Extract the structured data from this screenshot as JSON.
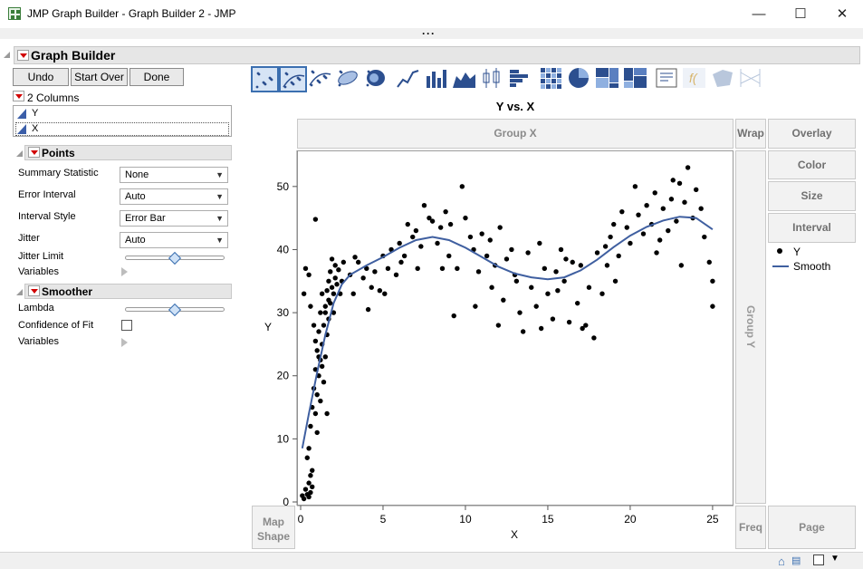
{
  "window": {
    "title": "JMP Graph Builder - Graph Builder 2 - JMP",
    "minimize": "—",
    "maximize": "☐",
    "close": "✕",
    "more": "···"
  },
  "graph_builder": {
    "title": "Graph Builder",
    "buttons": {
      "undo": "Undo",
      "start_over": "Start Over",
      "done": "Done"
    },
    "columns_header": "2 Columns",
    "columns": [
      "Y",
      "X"
    ]
  },
  "points": {
    "title": "Points",
    "summary_statistic_label": "Summary Statistic",
    "summary_statistic_value": "None",
    "error_interval_label": "Error Interval",
    "error_interval_value": "Auto",
    "interval_style_label": "Interval Style",
    "interval_style_value": "Error Bar",
    "jitter_label": "Jitter",
    "jitter_value": "Auto",
    "jitter_limit_label": "Jitter Limit",
    "jitter_limit_level": 0.5,
    "variables_label": "Variables"
  },
  "smoother": {
    "title": "Smoother",
    "lambda_label": "Lambda",
    "lambda_level": 0.5,
    "confidence_label": "Confidence of Fit",
    "confidence_checked": false,
    "variables_label": "Variables"
  },
  "toolbar_icons": [
    "points-icon",
    "contour-points-icon",
    "smoother-icon",
    "ellipse-icon",
    "contour-icon",
    "line-icon",
    "bar-icon",
    "area-icon",
    "box-plot-icon",
    "histogram-icon",
    "heatmap-icon",
    "pie-icon",
    "treemap-icon",
    "mosaic-icon",
    "caption-box-icon",
    "formula-icon",
    "map-shapes-icon",
    "parallel-icon"
  ],
  "zones": {
    "group_x": "Group X",
    "wrap": "Wrap",
    "overlay": "Overlay",
    "color": "Color",
    "size": "Size",
    "interval": "Interval",
    "group_y": "Group Y",
    "map_shape_1": "Map",
    "map_shape_2": "Shape",
    "freq": "Freq",
    "page": "Page"
  },
  "legend": {
    "points_label": "Y",
    "smooth_label": "Smooth"
  },
  "colors": {
    "smooth_line": "#3f5fa0",
    "points": "#000000",
    "accent": "#3b6fb0"
  },
  "chart_data": {
    "type": "scatter",
    "title": "Y vs. X",
    "xlabel": "X",
    "ylabel": "Y",
    "xlim": [
      0,
      25.5
    ],
    "ylim": [
      0,
      55
    ],
    "xticks": [
      0,
      5,
      10,
      15,
      20,
      25
    ],
    "yticks": [
      0,
      10,
      20,
      30,
      40,
      50
    ],
    "grid": false,
    "legend_position": "right",
    "series": [
      {
        "name": "Y",
        "kind": "points",
        "points": [
          [
            0.1,
            1.0
          ],
          [
            0.2,
            0.5
          ],
          [
            0.3,
            2.0
          ],
          [
            0.4,
            1.2
          ],
          [
            0.5,
            0.8
          ],
          [
            0.6,
            1.5
          ],
          [
            0.7,
            2.4
          ],
          [
            0.5,
            3.0
          ],
          [
            0.6,
            4.2
          ],
          [
            0.7,
            5.0
          ],
          [
            0.4,
            7.0
          ],
          [
            0.5,
            8.5
          ],
          [
            0.6,
            12.0
          ],
          [
            0.7,
            15.0
          ],
          [
            0.8,
            18.0
          ],
          [
            0.9,
            21.0
          ],
          [
            1.0,
            24.0
          ],
          [
            1.1,
            27.0
          ],
          [
            1.2,
            30.0
          ],
          [
            1.3,
            33.0
          ],
          [
            1.0,
            17.0
          ],
          [
            1.1,
            20.0
          ],
          [
            1.2,
            22.5
          ],
          [
            1.3,
            25.0
          ],
          [
            1.4,
            28.0
          ],
          [
            1.5,
            31.0
          ],
          [
            1.6,
            33.5
          ],
          [
            1.7,
            35.0
          ],
          [
            1.8,
            36.5
          ],
          [
            1.9,
            34.0
          ],
          [
            0.9,
            14.0
          ],
          [
            1.0,
            11.0
          ],
          [
            1.2,
            16.0
          ],
          [
            1.4,
            19.0
          ],
          [
            1.5,
            23.0
          ],
          [
            1.6,
            26.5
          ],
          [
            1.7,
            29.0
          ],
          [
            1.8,
            31.5
          ],
          [
            2.0,
            33.0
          ],
          [
            2.1,
            35.5
          ],
          [
            0.2,
            33.0
          ],
          [
            0.3,
            37.0
          ],
          [
            0.5,
            36.0
          ],
          [
            0.6,
            31.0
          ],
          [
            0.8,
            28.0
          ],
          [
            0.9,
            25.5
          ],
          [
            1.1,
            23.0
          ],
          [
            1.3,
            21.5
          ],
          [
            1.5,
            30.0
          ],
          [
            1.7,
            32.0
          ],
          [
            2.0,
            30.0
          ],
          [
            2.2,
            34.5
          ],
          [
            2.3,
            36.8
          ],
          [
            2.5,
            35.0
          ],
          [
            2.6,
            38.0
          ],
          [
            1.9,
            38.5
          ],
          [
            2.1,
            37.5
          ],
          [
            2.4,
            33.0
          ],
          [
            0.9,
            44.8
          ],
          [
            1.6,
            14.0
          ],
          [
            3.0,
            36.0
          ],
          [
            3.2,
            33.0
          ],
          [
            3.5,
            38.0
          ],
          [
            3.8,
            35.5
          ],
          [
            4.0,
            37.0
          ],
          [
            4.3,
            34.0
          ],
          [
            4.5,
            36.5
          ],
          [
            4.8,
            33.5
          ],
          [
            5.0,
            39.0
          ],
          [
            5.3,
            37.0
          ],
          [
            5.5,
            40.0
          ],
          [
            5.8,
            36.0
          ],
          [
            6.0,
            41.0
          ],
          [
            6.3,
            39.0
          ],
          [
            6.5,
            44.0
          ],
          [
            6.8,
            42.0
          ],
          [
            7.0,
            43.0
          ],
          [
            7.3,
            40.5
          ],
          [
            7.5,
            47.0
          ],
          [
            7.8,
            45.0
          ],
          [
            8.0,
            44.5
          ],
          [
            8.3,
            41.0
          ],
          [
            8.5,
            43.5
          ],
          [
            8.8,
            46.0
          ],
          [
            9.0,
            39.0
          ],
          [
            9.3,
            29.5
          ],
          [
            9.5,
            37.0
          ],
          [
            9.8,
            50.0
          ],
          [
            10.0,
            45.0
          ],
          [
            10.3,
            42.0
          ],
          [
            10.5,
            40.0
          ],
          [
            10.8,
            36.5
          ],
          [
            11.0,
            42.5
          ],
          [
            11.3,
            39.0
          ],
          [
            11.5,
            41.5
          ],
          [
            11.8,
            37.5
          ],
          [
            12.0,
            28.0
          ],
          [
            12.3,
            32.0
          ],
          [
            12.5,
            38.5
          ],
          [
            12.8,
            40.0
          ],
          [
            13.0,
            36.0
          ],
          [
            13.3,
            30.0
          ],
          [
            13.5,
            27.0
          ],
          [
            13.8,
            39.5
          ],
          [
            14.0,
            34.0
          ],
          [
            14.3,
            31.0
          ],
          [
            14.5,
            41.0
          ],
          [
            14.8,
            37.0
          ],
          [
            15.0,
            33.0
          ],
          [
            15.3,
            29.0
          ],
          [
            15.5,
            36.5
          ],
          [
            15.8,
            40.0
          ],
          [
            16.0,
            35.0
          ],
          [
            16.3,
            28.5
          ],
          [
            16.5,
            38.0
          ],
          [
            16.8,
            31.5
          ],
          [
            17.0,
            37.5
          ],
          [
            17.3,
            28.0
          ],
          [
            17.5,
            34.0
          ],
          [
            17.8,
            26.0
          ],
          [
            18.0,
            39.5
          ],
          [
            18.3,
            33.0
          ],
          [
            18.5,
            40.5
          ],
          [
            18.8,
            42.0
          ],
          [
            19.0,
            44.0
          ],
          [
            19.3,
            39.0
          ],
          [
            19.5,
            46.0
          ],
          [
            19.8,
            43.5
          ],
          [
            20.0,
            41.0
          ],
          [
            20.3,
            50.0
          ],
          [
            20.5,
            45.5
          ],
          [
            20.8,
            42.5
          ],
          [
            21.0,
            47.0
          ],
          [
            21.3,
            44.0
          ],
          [
            21.5,
            49.0
          ],
          [
            21.8,
            41.5
          ],
          [
            22.0,
            46.5
          ],
          [
            22.3,
            43.0
          ],
          [
            22.5,
            48.0
          ],
          [
            22.8,
            44.5
          ],
          [
            23.0,
            50.5
          ],
          [
            23.3,
            47.5
          ],
          [
            23.5,
            53.0
          ],
          [
            23.8,
            45.0
          ],
          [
            24.0,
            49.5
          ],
          [
            24.3,
            46.5
          ],
          [
            24.5,
            42.0
          ],
          [
            24.8,
            38.0
          ],
          [
            25.0,
            35.0
          ],
          [
            25.0,
            31.0
          ],
          [
            8.6,
            37.0
          ],
          [
            9.1,
            44.0
          ],
          [
            11.6,
            34.0
          ],
          [
            12.1,
            43.5
          ],
          [
            14.6,
            27.5
          ],
          [
            15.6,
            33.5
          ],
          [
            16.1,
            38.5
          ],
          [
            19.1,
            35.0
          ],
          [
            21.6,
            39.5
          ],
          [
            22.6,
            51.0
          ],
          [
            3.3,
            38.8
          ],
          [
            4.1,
            30.5
          ],
          [
            5.1,
            33.0
          ],
          [
            6.1,
            38.0
          ],
          [
            7.1,
            37.0
          ],
          [
            10.6,
            31.0
          ],
          [
            13.1,
            35.0
          ],
          [
            17.1,
            27.5
          ],
          [
            18.6,
            37.5
          ],
          [
            23.1,
            37.5
          ]
        ]
      },
      {
        "name": "Smooth",
        "kind": "line",
        "points": [
          [
            0.1,
            8.5
          ],
          [
            0.5,
            14.0
          ],
          [
            1.0,
            20.5
          ],
          [
            1.5,
            26.5
          ],
          [
            2.0,
            31.5
          ],
          [
            2.5,
            34.5
          ],
          [
            3.0,
            36.0
          ],
          [
            4.0,
            37.5
          ],
          [
            5.0,
            38.8
          ],
          [
            6.0,
            40.3
          ],
          [
            7.0,
            41.5
          ],
          [
            8.0,
            42.0
          ],
          [
            9.0,
            41.5
          ],
          [
            10.0,
            40.3
          ],
          [
            11.0,
            38.8
          ],
          [
            12.0,
            37.3
          ],
          [
            13.0,
            36.2
          ],
          [
            14.0,
            35.6
          ],
          [
            15.0,
            35.3
          ],
          [
            16.0,
            35.6
          ],
          [
            17.0,
            36.7
          ],
          [
            18.0,
            38.4
          ],
          [
            19.0,
            40.4
          ],
          [
            20.0,
            42.2
          ],
          [
            21.0,
            43.6
          ],
          [
            22.0,
            44.6
          ],
          [
            23.0,
            45.2
          ],
          [
            24.0,
            45.0
          ],
          [
            25.0,
            43.2
          ]
        ]
      }
    ]
  }
}
